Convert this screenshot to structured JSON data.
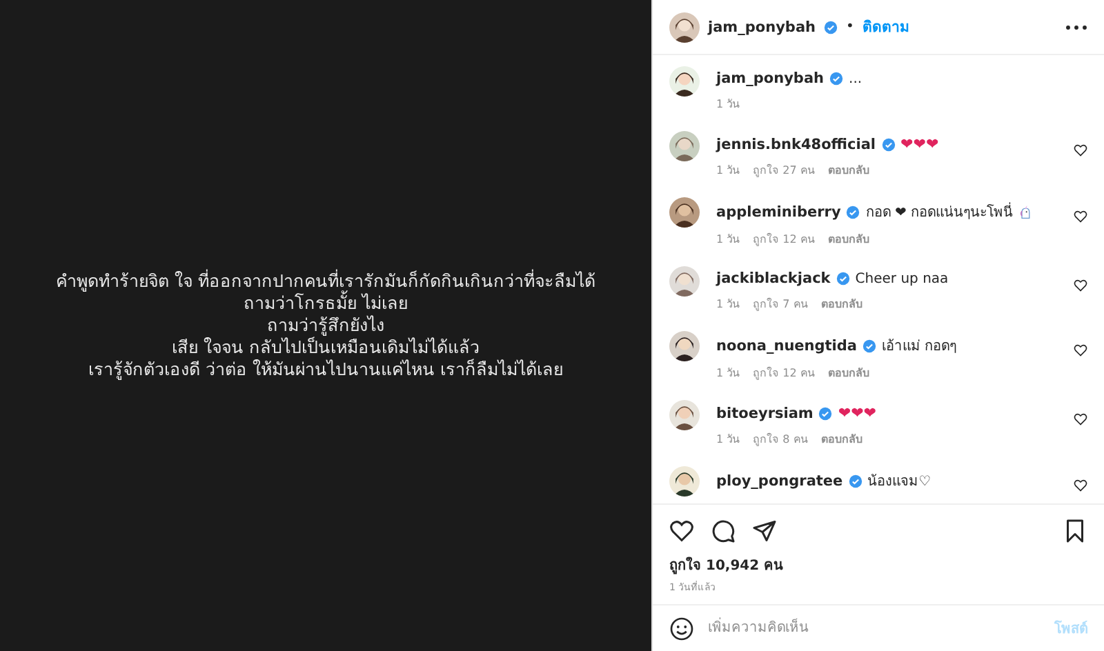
{
  "post": {
    "kind": "picture-text",
    "lines": [
      "คำพูดทำร้ายจิต ใจ ที่ออกจากปากคนที่เรารักมันก็กัดกินเกินกว่าที่จะลืมได้",
      "ถามว่าโกรธมั้ย ไม่เลย",
      "ถามว่ารู้สึกยังไง",
      "เสีย ใจจน กลับไปเป็นเหมือนเดิมไม่ได้แล้ว",
      "เรารู้จักตัวเองดี ว่าต่อ ให้มันผ่านไปนานแค่ไหน เราก็ลืมไม่ได้เลย"
    ]
  },
  "header": {
    "username": "jam_ponybah",
    "verified": true,
    "separator": "•",
    "follow": "ติดตาม"
  },
  "caption": {
    "username": "jam_ponybah",
    "verified": true,
    "text": "...",
    "time": "1 วัน"
  },
  "comments": [
    {
      "username": "jennis.bnk48official",
      "verified": true,
      "text": "❤❤❤",
      "kind": "hearts",
      "time": "1 วัน",
      "likes": "ถูกใจ 27 คน",
      "reply": "ตอบกลับ"
    },
    {
      "username": "appleminiberry",
      "verified": true,
      "text": "กอด ❤ กอดแน่นๆนะโพนี่",
      "kind": "text-icon",
      "time": "1 วัน",
      "likes": "ถูกใจ 12 คน",
      "reply": "ตอบกลับ"
    },
    {
      "username": "jackiblackjack",
      "verified": true,
      "text": "Cheer up naa",
      "kind": "text",
      "time": "1 วัน",
      "likes": "ถูกใจ 7 คน",
      "reply": "ตอบกลับ"
    },
    {
      "username": "noona_nuengtida",
      "verified": true,
      "text": "เอ้าแม่ กอดๆ",
      "kind": "text",
      "time": "1 วัน",
      "likes": "ถูกใจ 12 คน",
      "reply": "ตอบกลับ"
    },
    {
      "username": "bitoeyrsiam",
      "verified": true,
      "text": "❤❤❤",
      "kind": "hearts",
      "time": "1 วัน",
      "likes": "ถูกใจ 8 คน",
      "reply": "ตอบกลับ"
    },
    {
      "username": "ploy_pongratee",
      "verified": true,
      "text": "น้องแจม♡",
      "kind": "text"
    }
  ],
  "likes": "ถูกใจ 10,942 คน",
  "posted": "1 วันที่แล้ว",
  "comment_box": {
    "placeholder": "เพิ่มความคิดเห็น",
    "post": "โพสต์",
    "post_disabled": true
  }
}
